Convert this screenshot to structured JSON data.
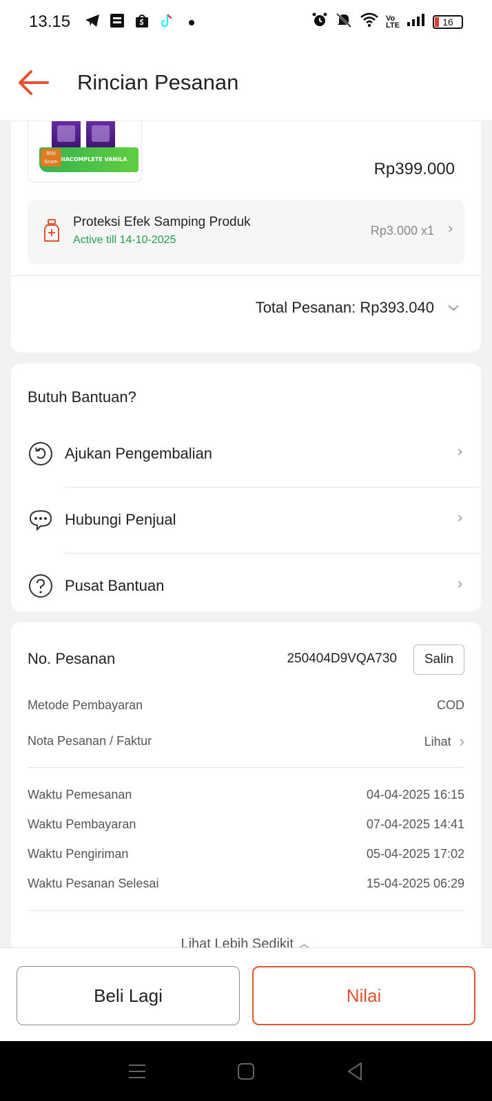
{
  "status_bar": {
    "time": "13.15",
    "battery": "16",
    "icons": [
      "telegram-icon",
      "brimo-icon",
      "shop-icon",
      "tiktok-icon",
      "dot-icon",
      "alarm-icon",
      "mute-icon",
      "wifi-icon",
      "volte-icon",
      "signal-icon",
      "battery-icon"
    ]
  },
  "header": {
    "title": "Rincian Pesanan"
  },
  "product": {
    "image_badge": "800 Gram",
    "image_label": "PEDIACOMPLETE VANILA",
    "price": "Rp399.000"
  },
  "protection": {
    "title": "Proteksi Efek Samping Produk",
    "subtitle": "Active till 14-10-2025",
    "price": "Rp3.000 x1"
  },
  "order_total": {
    "label": "Total Pesanan: Rp393.040"
  },
  "help": {
    "title": "Butuh Bantuan?",
    "items": [
      {
        "label": "Ajukan Pengembalian",
        "icon": "return-icon"
      },
      {
        "label": "Hubungi Penjual",
        "icon": "chat-icon"
      },
      {
        "label": "Pusat Bantuan",
        "icon": "help-circle-icon"
      }
    ]
  },
  "order_info": {
    "order_no_label": "No. Pesanan",
    "order_no_value": "250404D9VQA730",
    "copy_label": "Salin",
    "payment_label": "Metode Pembayaran",
    "payment_value": "COD",
    "invoice_label": "Nota Pesanan / Faktur",
    "invoice_link": "Lihat",
    "times": [
      {
        "label": "Waktu Pemesanan",
        "value": "04-04-2025 16:15"
      },
      {
        "label": "Waktu Pembayaran",
        "value": "07-04-2025 14:41"
      },
      {
        "label": "Waktu Pengiriman",
        "value": "05-04-2025 17:02"
      },
      {
        "label": "Waktu Pesanan Selesai",
        "value": "15-04-2025 06:29"
      }
    ],
    "see_less": "Lihat Lebih Sedikit"
  },
  "actions": {
    "buy_again": "Beli Lagi",
    "rate": "Nilai"
  },
  "colors": {
    "accent": "#e15331",
    "green": "#1f9e4a"
  }
}
